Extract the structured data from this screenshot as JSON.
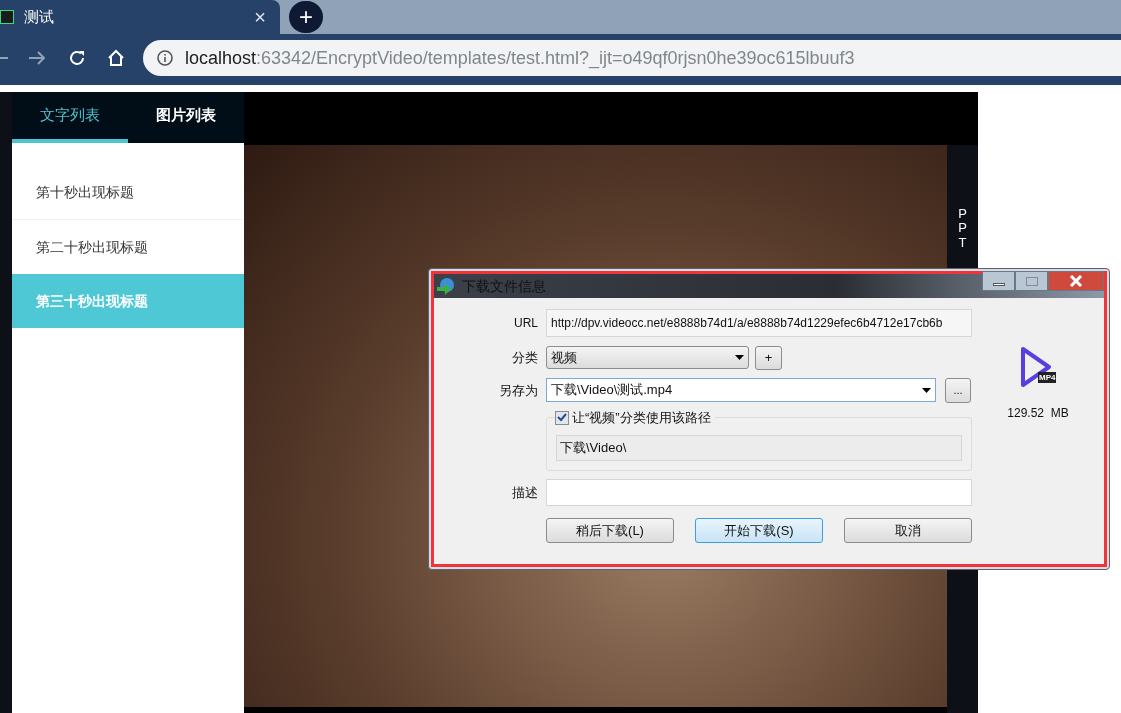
{
  "browser": {
    "tab": {
      "title": "测试",
      "close": "×"
    },
    "new_tab": "+",
    "address": {
      "host": "localhost",
      "path": ":63342/EncryptVideo/templates/test.html?_ijt=o49qf0rjsn0he39oc615lbuuf3"
    }
  },
  "sidebar": {
    "tabs": [
      {
        "label": "文字列表",
        "selected": true
      },
      {
        "label": "图片列表",
        "selected": false
      }
    ],
    "items": [
      {
        "label": "第十秒出现标题",
        "selected": false
      },
      {
        "label": "第二十秒出现标题",
        "selected": false
      },
      {
        "label": "第三十秒出现标题",
        "selected": true
      }
    ]
  },
  "player": {
    "side_label": "PPT"
  },
  "dialog": {
    "title": "下载文件信息",
    "url_label": "URL",
    "url": "http://dpv.videocc.net/e8888b74d1/a/e8888b74d1229efec6b4712e17cb6b",
    "category_label": "分类",
    "category": "视频",
    "add_button": "+",
    "save_as_label": "另存为",
    "save_as": "下载\\Video\\测试.mp4",
    "browse_button": "...",
    "remember": {
      "label": "让“视频”分类使用该路径",
      "checked": true
    },
    "remember_path": "下载\\Video\\",
    "description_label": "描述",
    "file_type": "MP4",
    "file_size": "129.52  MB",
    "buttons": [
      {
        "label": "稍后下载(L)",
        "selected": false
      },
      {
        "label": "开始下载(S)",
        "selected": true
      },
      {
        "label": "取消",
        "selected": false
      }
    ]
  }
}
